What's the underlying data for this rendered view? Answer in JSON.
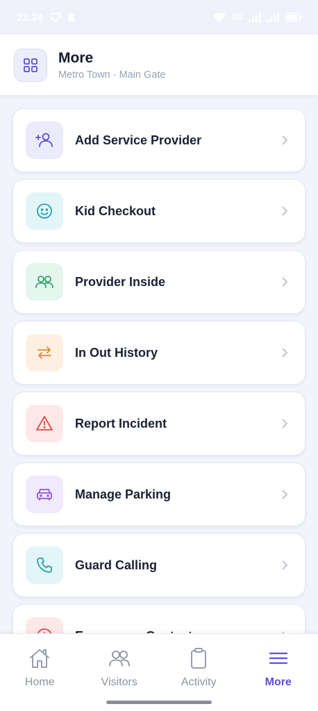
{
  "status_bar": {
    "time": "23:24",
    "network": "5G"
  },
  "header": {
    "title": "More",
    "subtitle": "Metro Town · Main Gate",
    "icon": "grid-icon"
  },
  "menu": [
    {
      "label": "Add Service Provider",
      "icon": "user-plus-icon",
      "icon_color": "#5b4fd6",
      "icon_bg": "#ecebfb"
    },
    {
      "label": "Kid Checkout",
      "icon": "smile-icon",
      "icon_color": "#1fa3b5",
      "icon_bg": "#e4f5f7"
    },
    {
      "label": "Provider Inside",
      "icon": "users-icon",
      "icon_color": "#2ea36b",
      "icon_bg": "#e5f6ee"
    },
    {
      "label": "In Out History",
      "icon": "swap-arrows-icon",
      "icon_color": "#e08a2a",
      "icon_bg": "#fdf0e2"
    },
    {
      "label": "Report Incident",
      "icon": "warning-icon",
      "icon_color": "#e04848",
      "icon_bg": "#fde8e8"
    },
    {
      "label": "Manage Parking",
      "icon": "car-icon",
      "icon_color": "#8b55d8",
      "icon_bg": "#f1e9fc"
    },
    {
      "label": "Guard Calling",
      "icon": "phone-icon",
      "icon_color": "#1fa3b5",
      "icon_bg": "#e4f5f7"
    },
    {
      "label": "Emergency Contact",
      "icon": "alert-circle-icon",
      "icon_color": "#e04848",
      "icon_bg": "#fde8e8"
    }
  ],
  "bottom_nav": {
    "items": [
      {
        "label": "Home",
        "icon": "home-icon",
        "active": false
      },
      {
        "label": "Visitors",
        "icon": "users-icon",
        "active": false
      },
      {
        "label": "Activity",
        "icon": "clipboard-icon",
        "active": false
      },
      {
        "label": "More",
        "icon": "menu-icon",
        "active": true
      }
    ],
    "active_color": "#5a4fd4",
    "inactive_color": "#8c91a3"
  }
}
